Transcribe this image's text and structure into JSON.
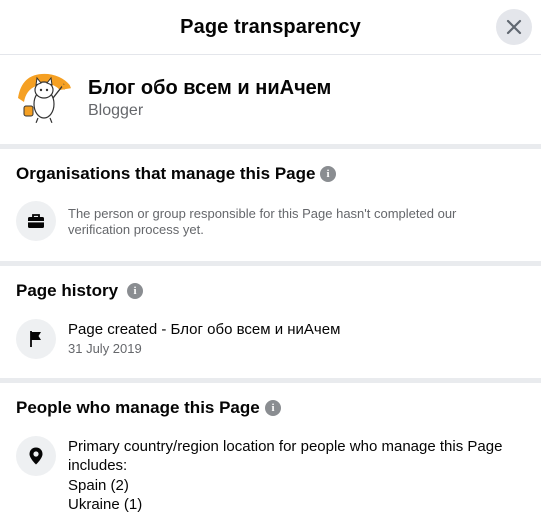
{
  "dialog": {
    "title": "Page transparency",
    "close_icon": "close-icon"
  },
  "profile": {
    "name": "Блог обо всем и ниАчем",
    "category": "Blogger",
    "avatar_icon": "cartoon-cat-avatar"
  },
  "organisations": {
    "title": "Organisations that manage this Page",
    "info_icon": "info-icon",
    "row_icon": "briefcase-icon",
    "text": "The person or group responsible for this Page hasn't completed our verification process yet."
  },
  "history": {
    "title": "Page history",
    "info_icon": "info-icon",
    "row_icon": "flag-icon",
    "event": "Page created - Блог обо всем и ниАчем",
    "date": "31 July 2019"
  },
  "managers": {
    "title": "People who manage this Page",
    "info_icon": "info-icon",
    "row_icon": "location-pin-icon",
    "intro": "Primary country/region location for people who manage this Page includes:",
    "countries": [
      "Spain (2)",
      "Ukraine (1)"
    ]
  },
  "colors": {
    "divider": "#e9ebee",
    "secondary_text": "#65676b",
    "icon_bg": "#eef0f2",
    "avatar_orange": "#f5a023"
  }
}
